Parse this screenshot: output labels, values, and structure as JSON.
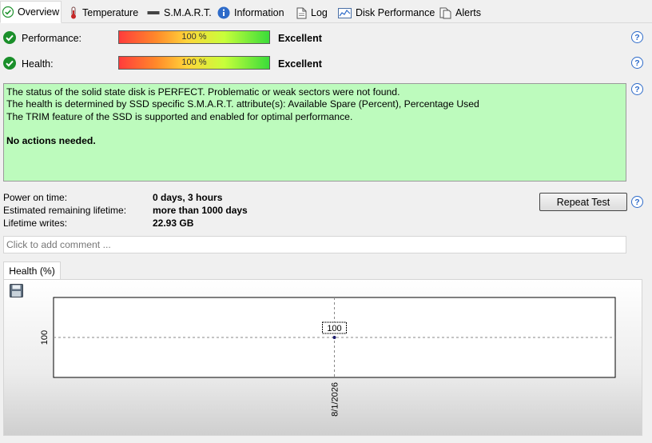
{
  "tabs": [
    {
      "label": "Overview",
      "icon": "check-icon"
    },
    {
      "label": "Temperature",
      "icon": "thermometer-icon"
    },
    {
      "label": "S.M.A.R.T.",
      "icon": "drive-icon"
    },
    {
      "label": "Information",
      "icon": "info-icon"
    },
    {
      "label": "Log",
      "icon": "log-icon"
    },
    {
      "label": "Disk Performance",
      "icon": "performance-chart-icon"
    },
    {
      "label": "Alerts",
      "icon": "alerts-icon"
    }
  ],
  "performance": {
    "label": "Performance:",
    "value": "100 %",
    "percent": 100,
    "rating": "Excellent"
  },
  "health": {
    "label": "Health:",
    "value": "100 %",
    "percent": 100,
    "rating": "Excellent"
  },
  "status": {
    "lines": [
      "The status of the solid state disk is PERFECT. Problematic or weak sectors were not found.",
      "The health is determined by SSD specific S.M.A.R.T. attribute(s):  Available Spare (Percent), Percentage Used",
      "The TRIM feature of the SSD is supported and enabled for optimal performance."
    ],
    "action": "No actions needed.",
    "background": "#bdfbbd"
  },
  "stats": [
    {
      "label": "Power on time:",
      "value": "0 days, 3 hours"
    },
    {
      "label": "Estimated remaining lifetime:",
      "value": "more than 1000 days"
    },
    {
      "label": "Lifetime writes:",
      "value": "22.93 GB"
    }
  ],
  "repeat_test_label": "Repeat Test",
  "help_label": "?",
  "comment": {
    "placeholder": "Click to add comment ..."
  },
  "chart_tab": "Health (%)",
  "chart_data": {
    "type": "line",
    "points": [
      {
        "x": "8/1/2026",
        "y": 100
      }
    ],
    "data_labels": [
      "100"
    ],
    "y_ticks": [
      "100"
    ],
    "x_ticks": [
      "8/1/2026"
    ],
    "grid": "dashed crosshair",
    "legend": "none"
  }
}
